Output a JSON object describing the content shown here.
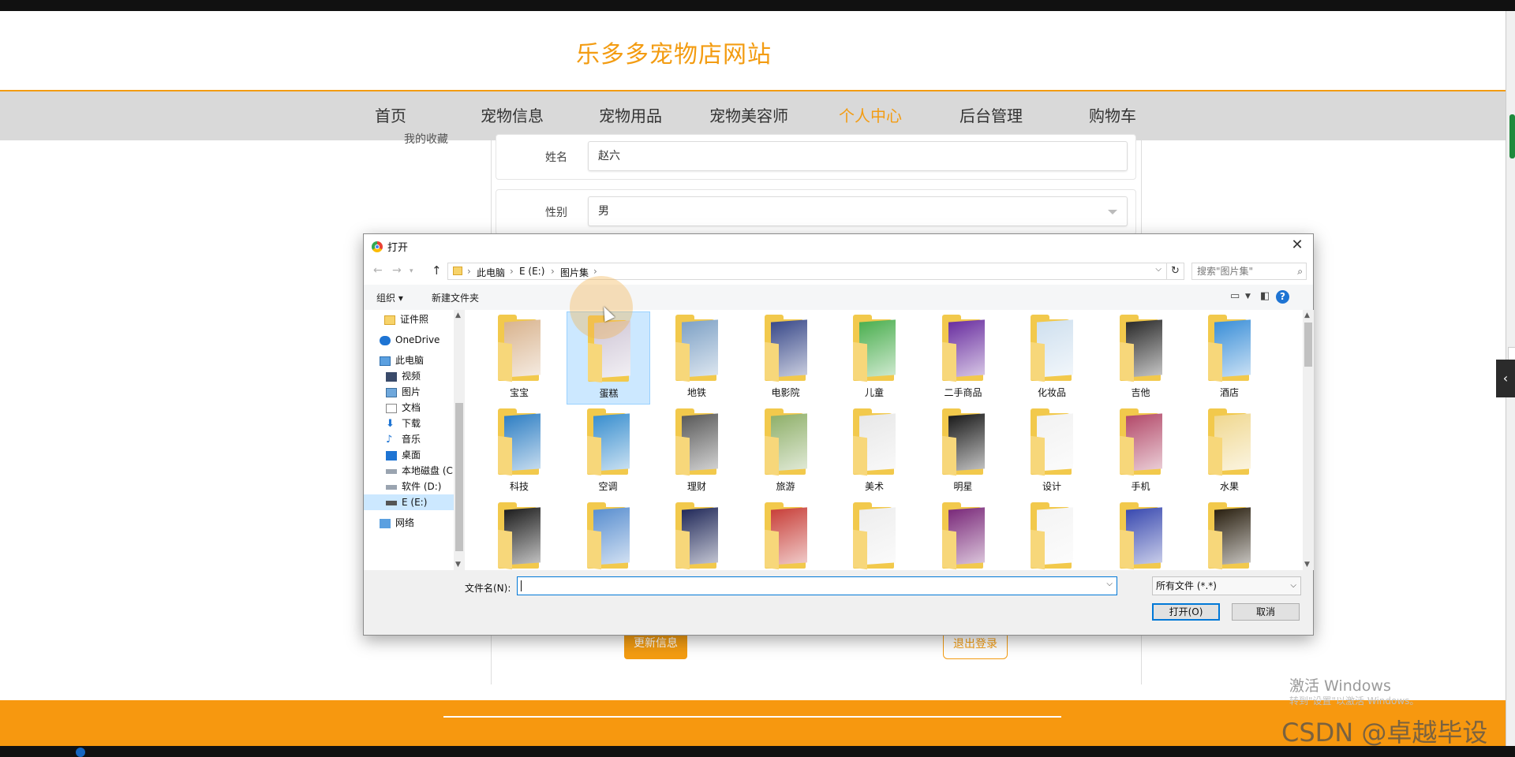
{
  "site": {
    "title": "乐多多宠物店网站",
    "nav": [
      {
        "label": "首页",
        "active": false
      },
      {
        "label": "宠物信息",
        "active": false
      },
      {
        "label": "宠物用品",
        "active": false
      },
      {
        "label": "宠物美容师",
        "active": false
      },
      {
        "label": "个人中心",
        "active": true
      },
      {
        "label": "后台管理",
        "active": false
      },
      {
        "label": "购物车",
        "active": false
      }
    ],
    "accent_color": "#f39c12"
  },
  "profile_form": {
    "sidebar_fragment": "我的收藏",
    "name_label": "姓名",
    "name_value": "赵六",
    "gender_label": "性别",
    "gender_value": "男",
    "update_button": "更新信息",
    "logout_button": "退出登录"
  },
  "file_dialog": {
    "title": "打开",
    "close_glyph": "✕",
    "breadcrumbs": [
      "此电脑",
      "E (E:)",
      "图片集"
    ],
    "search_placeholder": "搜索\"图片集\"",
    "toolbar": {
      "organize": "组织 ▾",
      "new_folder": "新建文件夹"
    },
    "tree": [
      {
        "label": "证件照",
        "icon": "folder-icon",
        "selected": false
      },
      {
        "label": "OneDrive",
        "icon": "cloud-icon",
        "selected": false
      },
      {
        "label": "此电脑",
        "icon": "computer-icon",
        "selected": false
      },
      {
        "label": "视频",
        "icon": "video-icon",
        "selected": false
      },
      {
        "label": "图片",
        "icon": "picture-icon",
        "selected": false
      },
      {
        "label": "文档",
        "icon": "document-icon",
        "selected": false
      },
      {
        "label": "下载",
        "icon": "download-icon",
        "selected": false
      },
      {
        "label": "音乐",
        "icon": "music-icon",
        "selected": false
      },
      {
        "label": "桌面",
        "icon": "desktop-icon",
        "selected": false
      },
      {
        "label": "本地磁盘 (C:)",
        "icon": "drive-icon",
        "selected": false
      },
      {
        "label": "软件 (D:)",
        "icon": "drive-icon",
        "selected": false
      },
      {
        "label": "E (E:)",
        "icon": "drive-icon",
        "selected": true
      },
      {
        "label": "网络",
        "icon": "network-icon",
        "selected": false
      }
    ],
    "folders": [
      {
        "name": "宝宝",
        "preview": "#d9b48f"
      },
      {
        "name": "蛋糕",
        "preview": "#cfc6d6",
        "selected": true
      },
      {
        "name": "地铁",
        "preview": "#7fa2c6"
      },
      {
        "name": "电影院",
        "preview": "#3a4a8a"
      },
      {
        "name": "儿童",
        "preview": "#4caf50"
      },
      {
        "name": "二手商品",
        "preview": "#6a2fa0"
      },
      {
        "name": "化妆品",
        "preview": "#cfe0ef"
      },
      {
        "name": "吉他",
        "preview": "#2b2b2b"
      },
      {
        "name": "酒店",
        "preview": "#3b8fd8"
      },
      {
        "name": "科技",
        "preview": "#2f7fc4"
      },
      {
        "name": "空调",
        "preview": "#3a8fcf"
      },
      {
        "name": "理财",
        "preview": "#5a5a5a"
      },
      {
        "name": "旅游",
        "preview": "#8fb06a"
      },
      {
        "name": "美术",
        "preview": "#e8e8e8"
      },
      {
        "name": "明星",
        "preview": "#1b1b1b"
      },
      {
        "name": "设计",
        "preview": "#f2f2f2"
      },
      {
        "name": "手机",
        "preview": "#b34a6a"
      },
      {
        "name": "水果",
        "preview": "#f0d890"
      },
      {
        "name": "",
        "preview": "#1e1e1e"
      },
      {
        "name": "",
        "preview": "#5a8fd0"
      },
      {
        "name": "",
        "preview": "#222a5a"
      },
      {
        "name": "",
        "preview": "#c8403a"
      },
      {
        "name": "",
        "preview": "#eeeeee"
      },
      {
        "name": "",
        "preview": "#7a2a7a"
      },
      {
        "name": "",
        "preview": "#f4f4f4"
      },
      {
        "name": "",
        "preview": "#3a4ab0"
      },
      {
        "name": "",
        "preview": "#2a2010"
      }
    ],
    "filename_label": "文件名(N):",
    "filename_value": "",
    "filter_value": "所有文件 (*.*)",
    "open_button": "打开(O)",
    "cancel_button": "取消"
  },
  "watermarks": {
    "activate_windows": "激活 Windows",
    "activate_sub": "转到\"设置\"以激活 Windows。",
    "csdn": "CSDN @卓越毕设"
  }
}
